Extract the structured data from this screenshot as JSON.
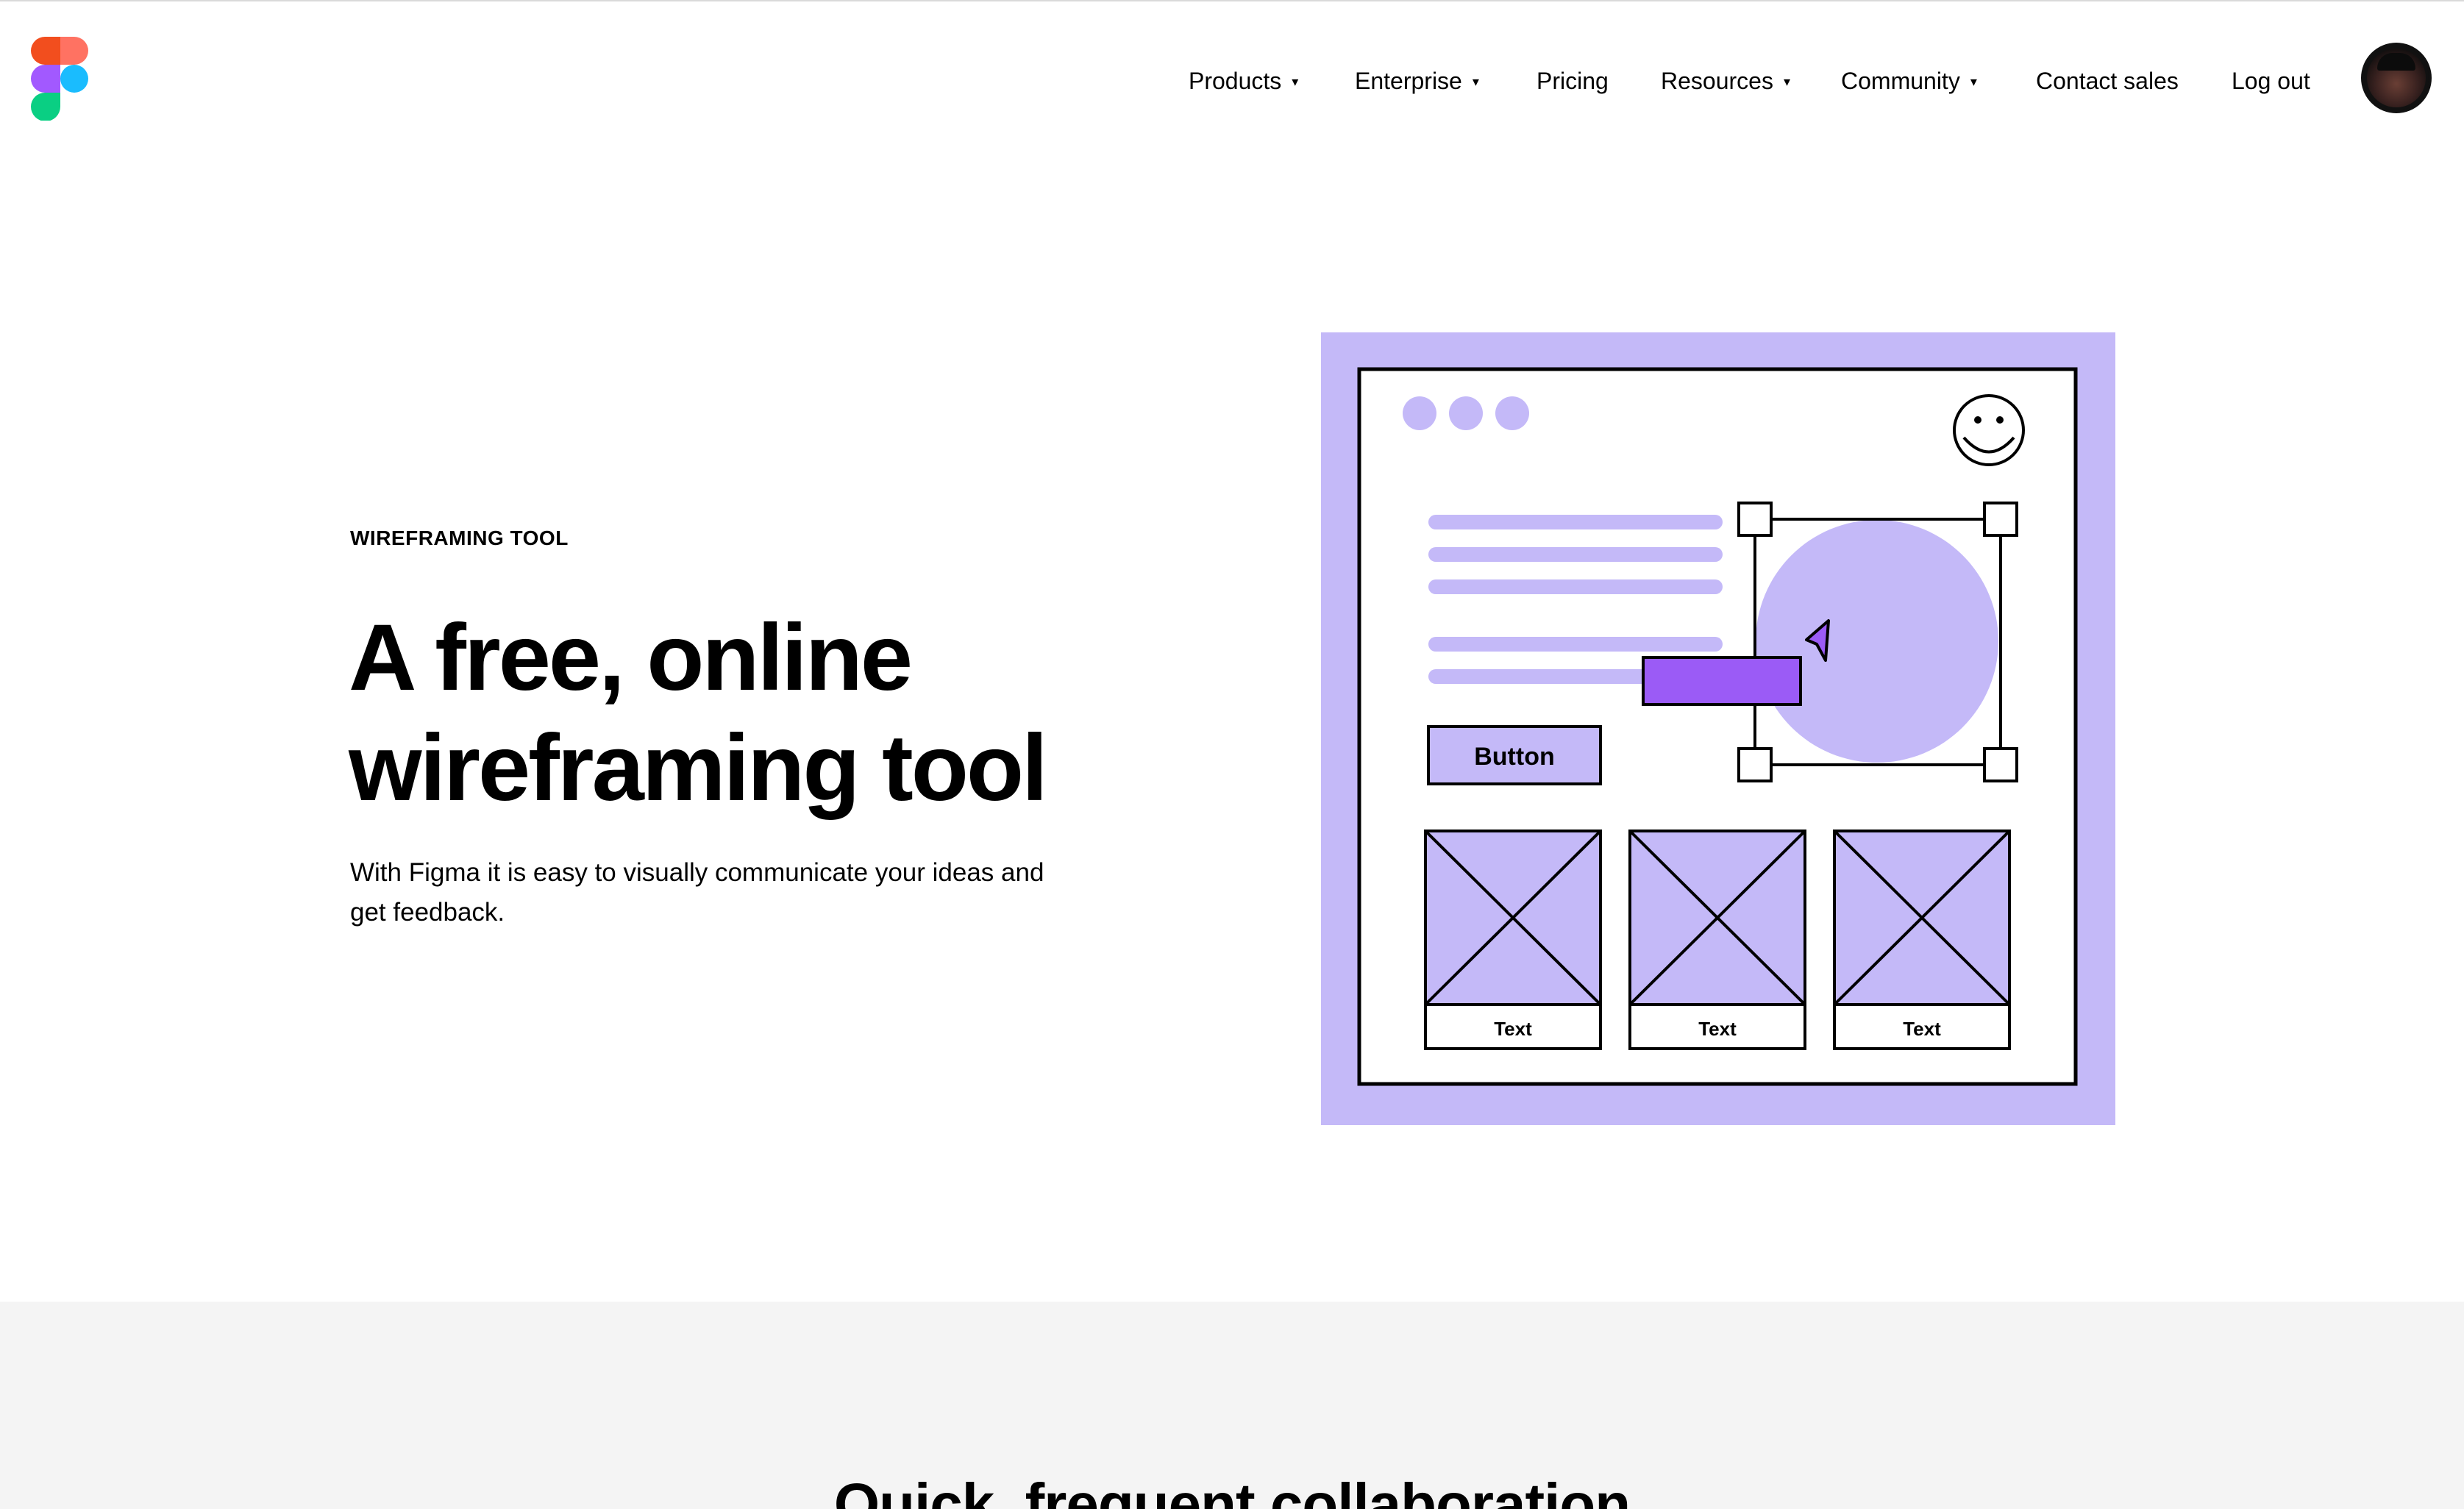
{
  "nav": {
    "items": [
      {
        "label": "Products",
        "caret": "▾"
      },
      {
        "label": "Enterprise",
        "caret": "▾"
      },
      {
        "label": "Pricing"
      },
      {
        "label": "Resources",
        "caret": "▾"
      },
      {
        "label": "Community",
        "caret": "▾"
      },
      {
        "label": "Contact sales"
      },
      {
        "label": "Log out"
      }
    ]
  },
  "hero": {
    "eyebrow": "WIREFRAMING TOOL",
    "headline": "A free, online wireframing tool",
    "subtext": "With Figma it is easy to visually communicate your ideas and get feedback."
  },
  "illustration": {
    "button_label": "Button",
    "card_labels": [
      "Text",
      "Text",
      "Text"
    ],
    "colors": {
      "lavender": "#c4b9f8",
      "purple": "#9b5bf6",
      "stroke": "#000000"
    }
  },
  "next_section": {
    "title": "Quick, frequent collaboration"
  },
  "brand": {
    "colors": [
      "#f24e1e",
      "#ff7262",
      "#a259ff",
      "#1abcfe",
      "#0acf83"
    ]
  }
}
